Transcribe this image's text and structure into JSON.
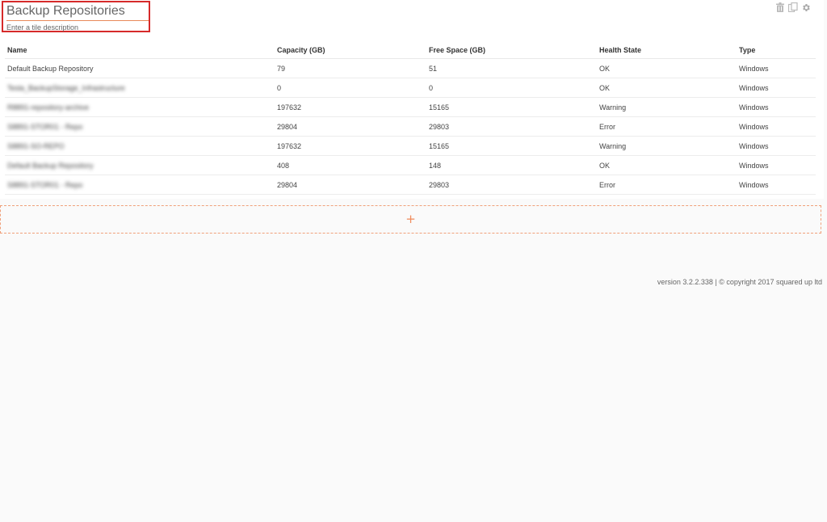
{
  "tile": {
    "title": "Backup Repositories",
    "description_placeholder": "Enter a tile description"
  },
  "toolbar": {
    "icons": [
      "trash-icon",
      "copy-icon",
      "gear-icon"
    ]
  },
  "table": {
    "headers": [
      "Name",
      "Capacity (GB)",
      "Free Space (GB)",
      "Health State",
      "Type"
    ],
    "rows": [
      {
        "name": "Default Backup Repository",
        "capacity": "79",
        "free": "51",
        "health": "OK",
        "type": "Windows",
        "redacted": false
      },
      {
        "name": "Tesla_BackupStorage_Infrastructure",
        "capacity": "0",
        "free": "0",
        "health": "OK",
        "type": "Windows",
        "redacted": true
      },
      {
        "name": "R8891-repository-archive",
        "capacity": "197632",
        "free": "15165",
        "health": "Warning",
        "type": "Windows",
        "redacted": true
      },
      {
        "name": "S8891-STOR01 - Repo",
        "capacity": "29804",
        "free": "29803",
        "health": "Error",
        "type": "Windows",
        "redacted": true
      },
      {
        "name": "S8891-SO-REPO",
        "capacity": "197632",
        "free": "15165",
        "health": "Warning",
        "type": "Windows",
        "redacted": true
      },
      {
        "name": "Default Backup Repository",
        "capacity": "408",
        "free": "148",
        "health": "OK",
        "type": "Windows",
        "redacted": true
      },
      {
        "name": "S8891-STOR01 - Repo",
        "capacity": "29804",
        "free": "29803",
        "health": "Error",
        "type": "Windows",
        "redacted": true
      }
    ]
  },
  "add_tile": {
    "label": "+"
  },
  "footer": {
    "text": "version 3.2.2.338  | © copyright 2017 squared up ltd"
  },
  "colors": {
    "highlight_border": "#d62a2a",
    "accent": "#f08a5a",
    "background": "#fafafa"
  }
}
